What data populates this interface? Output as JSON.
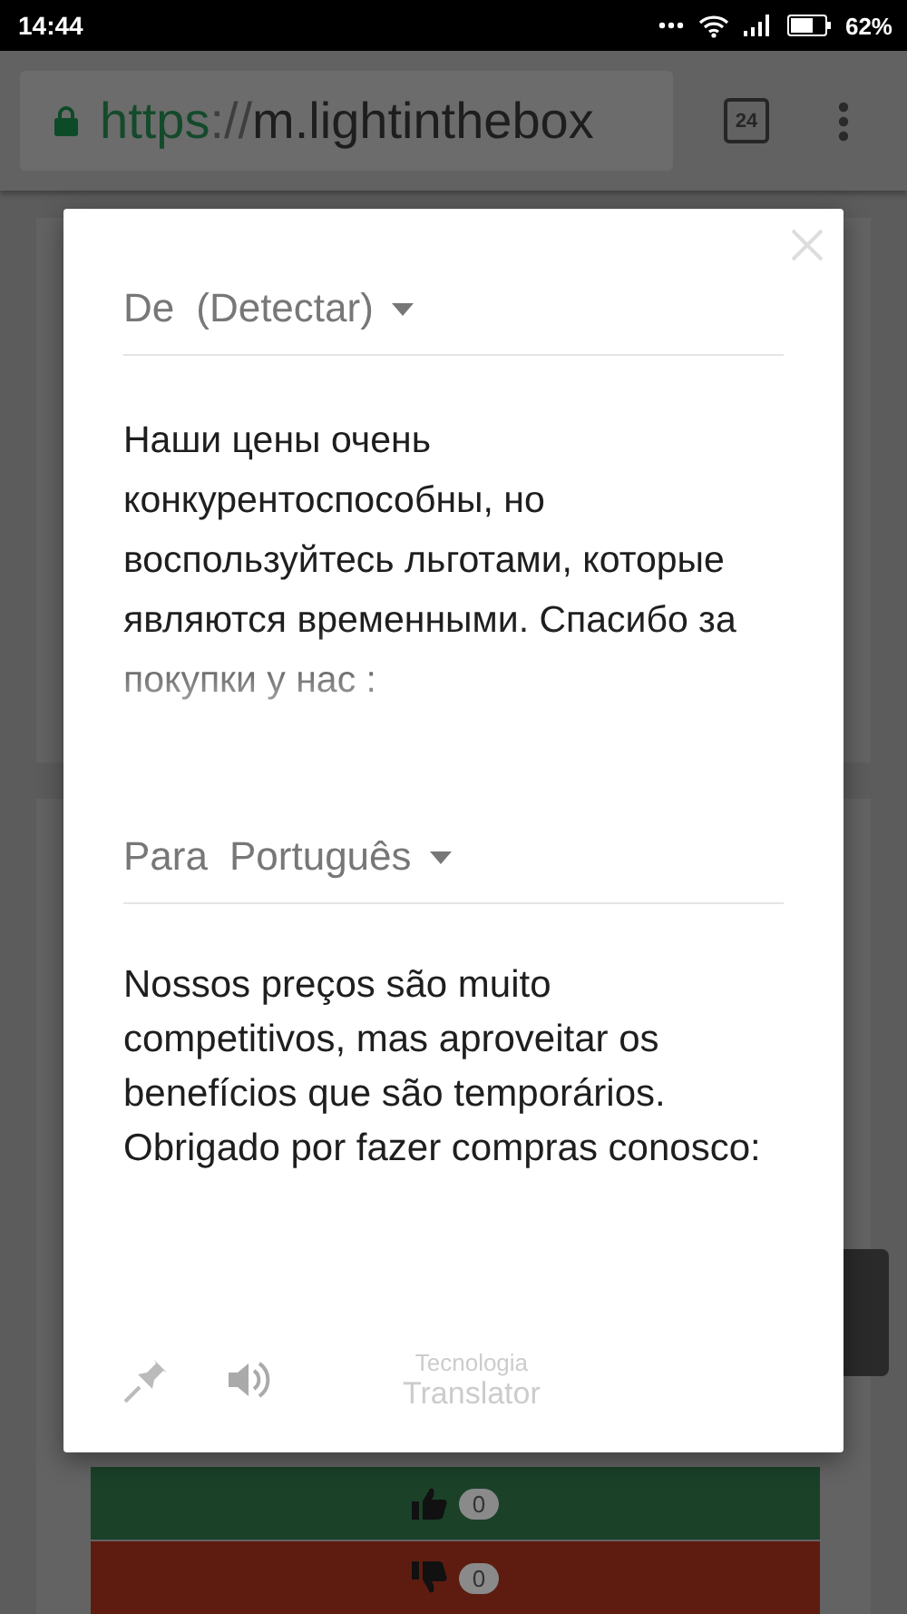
{
  "status_bar": {
    "time": "14:44",
    "battery_reading": "62%"
  },
  "browser": {
    "url_scheme": "https",
    "url_separator": "://",
    "url_host": "m.lightinthebox",
    "tab_count": "24"
  },
  "dialog": {
    "source": {
      "prefix": "De",
      "language": "(Detectar)",
      "text": "Наши цены очень конкурентоспособны, но воспользуйтесь льготами, которые являются временными. Спасибо за покупки у нас :"
    },
    "target": {
      "prefix": "Para",
      "language": "Português",
      "text": "Nossos preços são muito competitivos, mas aproveitar os benefícios que são temporários. Obrigado por fazer compras conosco:"
    },
    "credit": {
      "line_1": "Tecnologia",
      "line_2": "Translator"
    }
  },
  "votes": [
    {
      "kind": "up",
      "count": "0"
    },
    {
      "kind": "down",
      "count": "0"
    }
  ]
}
